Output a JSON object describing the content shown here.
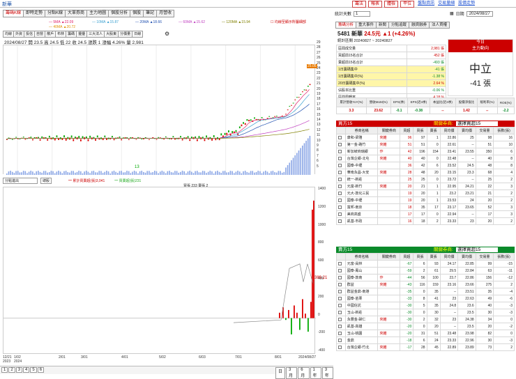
{
  "app": {
    "title": "新華"
  },
  "top_right": {
    "buttons": [
      "籌法",
      "報表",
      "體檢",
      "平位"
    ],
    "links": [
      "盤點資訊",
      "交易量細",
      "股價走勢"
    ]
  },
  "tabs": [
    "籌碼K線",
    "即時走勢",
    "分點K線",
    "大單券商",
    "主力地圖",
    "個股分析",
    "個股",
    "筆記",
    "月營收"
  ],
  "ma_legend": [
    {
      "label": "5MA ▲22.09",
      "color": "#e0206a"
    },
    {
      "label": "10MA ▲15.87",
      "color": "#3aa0d0"
    },
    {
      "label": "20MA ▲18.66",
      "color": "#2050b0"
    },
    {
      "label": "60MA ▲15.62",
      "color": "#c040c0"
    },
    {
      "label": "120MA ▲15.94",
      "color": "#808000"
    },
    {
      "label": "40MA ▲20.72",
      "color": "#e09000"
    }
  ],
  "ma_note": "☐ 均線至顯示所屬細部",
  "indicators": [
    "均線",
    "外資",
    "投信",
    "自營",
    "散戶",
    "布林",
    "籌碼",
    "擾擾",
    "三大法人",
    "大股東",
    "分價量",
    "日線"
  ],
  "price_info": "2024/08/27 開 23.5  高 24.5  低 22  收 24.5  漲跌 1  漲幅 4.26%  量 2,981",
  "price_axis": [
    "29",
    "28",
    "27",
    "26",
    "25",
    "24",
    "23",
    "22",
    "21",
    "20",
    "19",
    "18",
    "17",
    "16",
    "15",
    "14",
    "13",
    "12",
    "11",
    "10",
    "9",
    "8",
    "7",
    "6",
    "5"
  ],
  "last_price_tag": "25.05",
  "low_tag": "13",
  "lower_select": "分點進出",
  "lower_btn": "總股",
  "lower_legend1": "━ 累計買賣超(張)3,041",
  "lower_legend2": "━ 買賣超(張)231",
  "lower_legend3": "買張 233  賣張 2",
  "lower_axis": [
    "1400",
    "1200",
    "1000",
    "800",
    "600",
    "400",
    "200",
    "0",
    "-200",
    "-400"
  ],
  "lower_tag": "389.21",
  "date_axis": [
    "12/21\n2023",
    "1/02\n2024",
    "2/01",
    "3/01",
    "4/01",
    "5/02",
    "6/03",
    "7/01",
    "8/01",
    "2024/08/27"
  ],
  "bottom_pages": [
    "1",
    "2",
    "3",
    "4",
    "5",
    "6"
  ],
  "range_btns": [
    "日",
    "3月",
    "6月",
    "1年",
    "3年"
  ],
  "rp": {
    "stat_label": "統計天數",
    "stat_value": "1",
    "date_label": "日期",
    "date_value": "2024/08/27",
    "subtabs": [
      "籌碼分析",
      "重大事件",
      "新聞",
      "分點追蹤",
      "融資融券",
      "法人買權"
    ],
    "stock": "5481 新華",
    "price": "24.5元",
    "chg": "▲1 (+4.26%)",
    "period": "統計區間 20240827 ~ 20240827",
    "rows": [
      [
        "區間成交量",
        "2,981 張"
      ],
      [
        "買超前15名合計",
        "452 張"
      ],
      [
        "賣超前15名合計",
        "-493 張"
      ],
      [
        "1日籌碼集中",
        "-41 張"
      ],
      [
        "1日籌碼集中(%)",
        "-1.38 %"
      ],
      [
        "20日籌碼集中(%)",
        "2.64 %"
      ],
      [
        "佔股本比重",
        "-0.06 %"
      ],
      [
        "區間周轉率",
        "4.18 %"
      ]
    ],
    "today_label": "今日",
    "today_sub": "主力動向",
    "today_main": "中立",
    "today_val": "-41 張",
    "fin_heads": [
      "累計營收YoY(%)",
      "營收MoM(%)",
      "EPS(季)",
      "EPS(近4季)",
      "本益比(近4季)",
      "股價淨值比",
      "殖利率(%)",
      "ROE(%)"
    ],
    "fin_vals": [
      "3.3",
      "23.62",
      "-0.1",
      "-0.38",
      "--",
      "1.42",
      "--",
      "-2.2"
    ],
    "buy_title": "買方15",
    "sell_title": "賣方15",
    "opt_label": "關鍵券商:",
    "opt_value": "選擇買超15",
    "cols": [
      "券商名稱",
      "關鍵券商",
      "買超",
      "買張",
      "賣張",
      "買均價",
      "賣均價",
      "交易量",
      "張數(張)"
    ],
    "buy": [
      [
        "康和-梁雅",
        "夾雜",
        "96",
        "97",
        "1",
        "22.86",
        "25",
        "98",
        "16"
      ],
      [
        "第一金-路竹",
        "夾雜",
        "51",
        "51",
        "0",
        "22.61",
        "--",
        "51",
        "10"
      ],
      [
        "新加坡商瑞銀",
        "作",
        "42",
        "196",
        "154",
        "23.41",
        "23.55",
        "350",
        "6"
      ],
      [
        "台灣企銀-北屯",
        "夾雜",
        "40",
        "40",
        "0",
        "22.48",
        "--",
        "40",
        "8"
      ],
      [
        "國泰-中壢",
        "",
        "36",
        "42",
        "6",
        "23.52",
        "24.5",
        "48",
        "8"
      ],
      [
        "華南永昌-大安",
        "夾雜",
        "28",
        "48",
        "20",
        "23.15",
        "23.3",
        "68",
        "4"
      ],
      [
        "統一-新莊",
        "",
        "25",
        "25",
        "0",
        "23.72",
        "--",
        "25",
        "2"
      ],
      [
        "元富-新竹",
        "夾雜",
        "20",
        "21",
        "1",
        "22.95",
        "24.21",
        "22",
        "3"
      ],
      [
        "元大-敦化三民",
        "",
        "19",
        "20",
        "1",
        "23.2",
        "23.21",
        "21",
        "2"
      ],
      [
        "國泰-中壢",
        "",
        "19",
        "20",
        "1",
        "23.53",
        "24",
        "20",
        "2"
      ],
      [
        "富邦-南京",
        "",
        "18",
        "35",
        "17",
        "23.17",
        "23.65",
        "52",
        "3"
      ],
      [
        "美商高盛",
        "",
        "17",
        "17",
        "0",
        "22.94",
        "--",
        "17",
        "3"
      ],
      [
        "凱基-市政",
        "",
        "16",
        "18",
        "2",
        "23.33",
        "23",
        "20",
        "2"
      ]
    ],
    "sell": [
      [
        "元富-員林",
        "",
        "-67",
        "6",
        "93",
        "24.17",
        "22.85",
        "99",
        "-15"
      ],
      [
        "國泰-鳳山",
        "",
        "-59",
        "2",
        "61",
        "29.5",
        "22.84",
        "63",
        "-11"
      ],
      [
        "國泰-敦南",
        "作",
        "-44",
        "56",
        "100",
        "23.7",
        "22.86",
        "156",
        "-12"
      ],
      [
        "群益",
        "夾雜",
        "-43",
        "116",
        "159",
        "23.16",
        "23.66",
        "275",
        "2"
      ],
      [
        "群益金鼎-南港",
        "",
        "-35",
        "0",
        "35",
        "--",
        "23.51",
        "35",
        "-4"
      ],
      [
        "國泰-苗栗",
        "",
        "-33",
        "8",
        "41",
        "23",
        "22.63",
        "49",
        "-6"
      ],
      [
        "中國信託",
        "",
        "-30",
        "5",
        "35",
        "24.8",
        "23.6",
        "40",
        "-3"
      ],
      [
        "玉山-新莊",
        "",
        "-30",
        "0",
        "30",
        "--",
        "23.5",
        "30",
        "-3"
      ],
      [
        "永豐金-歸仁",
        "夾雜",
        "-30",
        "2",
        "32",
        "23",
        "24.38",
        "34",
        "0"
      ],
      [
        "凱基-高雄",
        "",
        "-20",
        "0",
        "20",
        "--",
        "23.5",
        "20",
        "-2"
      ],
      [
        "玉山-桃園",
        "夾雜",
        "-20",
        "31",
        "51",
        "23.48",
        "23.98",
        "82",
        "0"
      ],
      [
        "金鼎",
        "",
        "-18",
        "6",
        "24",
        "23.33",
        "22.96",
        "30",
        "-3"
      ],
      [
        "台灣企銀-竹北",
        "夾雜",
        "-17",
        "28",
        "45",
        "22.89",
        "23.89",
        "73",
        "2"
      ]
    ]
  }
}
